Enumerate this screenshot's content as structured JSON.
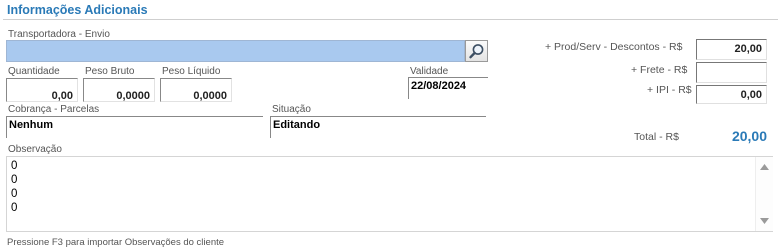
{
  "section": {
    "title": "Informações Adicionais"
  },
  "transport": {
    "label": "Transportadora - Envio",
    "value": ""
  },
  "quantity": {
    "label": "Quantidade",
    "value": "0,00"
  },
  "gross_weight": {
    "label": "Peso Bruto",
    "value": "0,0000"
  },
  "net_weight": {
    "label": "Peso Líquido",
    "value": "0,0000"
  },
  "validity": {
    "label": "Validade",
    "value": "22/08/2024"
  },
  "billing": {
    "label": "Cobrança - Parcelas",
    "value": "Nenhum"
  },
  "status": {
    "label": "Situação",
    "value": "Editando"
  },
  "totals": {
    "products_label": "+ Prod/Serv - Descontos - R$",
    "products_value": "20,00",
    "freight_label": "+ Frete - R$",
    "freight_value": "",
    "ipi_label": "+ IPI - R$",
    "ipi_value": "0,00",
    "total_label": "Total - R$",
    "total_value": "20,00"
  },
  "notes": {
    "label": "Observação",
    "lines": [
      "0",
      "0",
      "0",
      "0"
    ],
    "hint": "Pressione F3 para importar Observações do cliente"
  },
  "colors": {
    "accent": "#2a7ab7",
    "input_highlight": "#a9c9ef"
  }
}
